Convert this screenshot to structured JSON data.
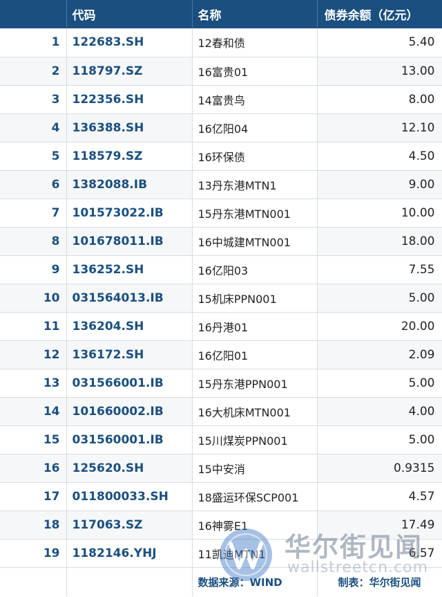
{
  "header": {
    "code": "代码",
    "name": "名称",
    "amount": "债券余额（亿元）"
  },
  "rows": [
    {
      "idx": "1",
      "code": "122683.SH",
      "name": "12春和债",
      "amount": "5.40"
    },
    {
      "idx": "2",
      "code": "118797.SZ",
      "name": "16富贵01",
      "amount": "13.00"
    },
    {
      "idx": "3",
      "code": "122356.SH",
      "name": "14富贵鸟",
      "amount": "8.00"
    },
    {
      "idx": "4",
      "code": "136388.SH",
      "name": "16亿阳04",
      "amount": "12.10"
    },
    {
      "idx": "5",
      "code": "118579.SZ",
      "name": "16环保债",
      "amount": "4.50"
    },
    {
      "idx": "6",
      "code": "1382088.IB",
      "name": "13丹东港MTN1",
      "amount": "9.00"
    },
    {
      "idx": "7",
      "code": "101573022.IB",
      "name": "15丹东港MTN001",
      "amount": "10.00"
    },
    {
      "idx": "8",
      "code": "101678011.IB",
      "name": "16中城建MTN001",
      "amount": "18.00"
    },
    {
      "idx": "9",
      "code": "136252.SH",
      "name": "16亿阳03",
      "amount": "7.55"
    },
    {
      "idx": "10",
      "code": "031564013.IB",
      "name": "15机床PPN001",
      "amount": "5.00"
    },
    {
      "idx": "11",
      "code": "136204.SH",
      "name": "16丹港01",
      "amount": "20.00"
    },
    {
      "idx": "12",
      "code": "136172.SH",
      "name": "16亿阳01",
      "amount": "2.09"
    },
    {
      "idx": "13",
      "code": "031566001.IB",
      "name": "15丹东港PPN001",
      "amount": "5.00"
    },
    {
      "idx": "14",
      "code": "101660002.IB",
      "name": "16大机床MTN001",
      "amount": "4.00"
    },
    {
      "idx": "15",
      "code": "031560001.IB",
      "name": "15川煤炭PPN001",
      "amount": "5.00"
    },
    {
      "idx": "16",
      "code": "125620.SH",
      "name": "15中安消",
      "amount": "0.9315"
    },
    {
      "idx": "17",
      "code": "011800033.SH",
      "name": "18盛运环保SCP001",
      "amount": "4.57"
    },
    {
      "idx": "18",
      "code": "117063.SZ",
      "name": "16神雾E1",
      "amount": "17.49"
    },
    {
      "idx": "19",
      "code": "1182146.YHJ",
      "name": "11凯迪MTN1",
      "amount": "6.57"
    }
  ],
  "footer": {
    "source": "数据来源：WIND",
    "maker": "制表：华尔街见闻"
  },
  "watermark": {
    "icon": "wallstreetcn-logo-icon",
    "title": "华尔街见闻",
    "url": "wallstreetcn.com"
  },
  "colors": {
    "header_bg": "#1a4f80",
    "accent_text": "#1a4f80",
    "row_alt_bg": "#f6f7f8"
  }
}
